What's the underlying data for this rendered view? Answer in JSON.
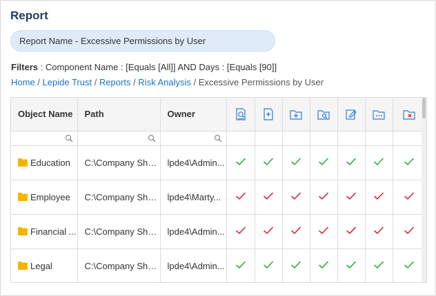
{
  "header": {
    "title": "Report"
  },
  "report_name_pill": "Report Name - Excessive Permissions by User",
  "filters": {
    "label": "Filters",
    "text": " : Component Name : [Equals [All]] AND Days : [Equals [90]]"
  },
  "breadcrumb": {
    "links": [
      "Home",
      "Lepide Trust",
      "Reports",
      "Risk Analysis"
    ],
    "current": "Excessive Permissions by User",
    "separator": " / "
  },
  "table": {
    "columns": [
      "Object Name",
      "Path",
      "Owner"
    ],
    "permission_icons": [
      "audit-icon",
      "create-file-icon",
      "create-folder-icon",
      "read-folder-icon",
      "write-icon",
      "list-folder-icon",
      "delete-folder-icon"
    ],
    "rows": [
      {
        "name": "Education",
        "path": "C:\\Company Sha...",
        "owner": "lpde4\\Admin...",
        "perms": [
          true,
          true,
          true,
          true,
          true,
          true,
          true
        ]
      },
      {
        "name": "Employee",
        "path": "C:\\Company Sha...",
        "owner": "lpde4\\Marty...",
        "perms": [
          true,
          true,
          true,
          true,
          true,
          true,
          true
        ]
      },
      {
        "name": "Financial ...",
        "path": "C:\\Company Sha...",
        "owner": "lpde4\\Admin...",
        "perms": [
          true,
          true,
          true,
          true,
          true,
          true,
          true
        ]
      },
      {
        "name": "Legal",
        "path": "C:\\Company Sha...",
        "owner": "lpde4\\Admin...",
        "perms": [
          true,
          true,
          true,
          true,
          true,
          true,
          true
        ]
      }
    ],
    "row_check_colors": [
      "#2eaa3f",
      "#d9253a",
      "#d9253a",
      "#2eaa3f"
    ]
  },
  "colors": {
    "accent": "#1a73c8",
    "icon_blue": "#2b7fd0",
    "folder": "#f5b400",
    "check_green": "#2eaa3f",
    "check_red": "#d9253a"
  }
}
